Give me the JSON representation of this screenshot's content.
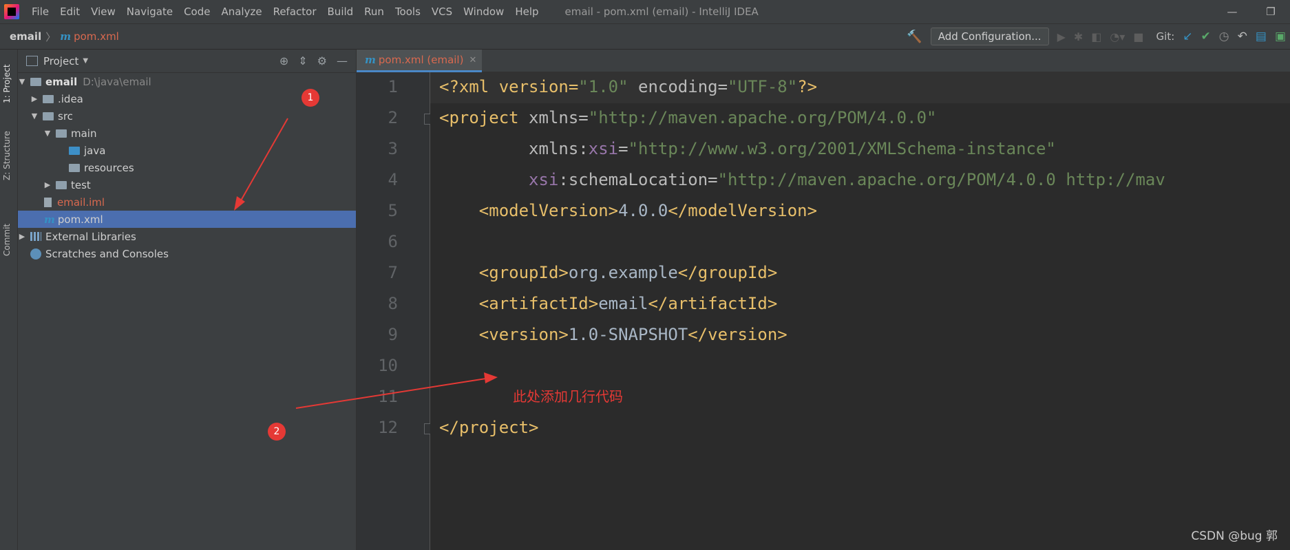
{
  "menubar": {
    "logo": "intellij-logo",
    "items": [
      "File",
      "Edit",
      "View",
      "Navigate",
      "Code",
      "Analyze",
      "Refactor",
      "Build",
      "Run",
      "Tools",
      "VCS",
      "Window",
      "Help"
    ],
    "window_title": "email - pom.xml (email) - IntelliJ IDEA",
    "minimize": "—",
    "restore": "❐"
  },
  "navbar": {
    "project": "email",
    "file": "pom.xml",
    "add_configuration": "Add Configuration...",
    "git_label": "Git:"
  },
  "sidebar_tabs": [
    "1: Project",
    "Z: Structure",
    "Commit"
  ],
  "project_panel": {
    "title": "Project",
    "tree": {
      "root": {
        "name": "email",
        "path": "D:\\java\\email"
      },
      "idea": ".idea",
      "src": "src",
      "main": "main",
      "java": "java",
      "resources": "resources",
      "test": "test",
      "email_iml": "email.iml",
      "pom": "pom.xml",
      "external_libraries": "External Libraries",
      "scratches": "Scratches and Consoles"
    }
  },
  "editor": {
    "tab_label": "pom.xml (email)",
    "line_numbers": [
      "1",
      "2",
      "3",
      "4",
      "5",
      "6",
      "7",
      "8",
      "9",
      "10",
      "11",
      "12"
    ],
    "lines": {
      "l1": {
        "a": "<?xml version=",
        "b": "\"1.0\"",
        "c": " encoding=",
        "d": "\"UTF-8\"",
        "e": "?>"
      },
      "l2": {
        "a": "<project ",
        "b": "xmlns",
        "c": "=",
        "d": "\"http://maven.apache.org/POM/4.0.0\""
      },
      "l3": {
        "a": "         xmlns:",
        "b": "xsi",
        "c": "=",
        "d": "\"http://www.w3.org/2001/XMLSchema-instance\""
      },
      "l4": {
        "a": "         ",
        "b": "xsi",
        "c": ":schemaLocation=",
        "d": "\"http://maven.apache.org/POM/4.0.0 http://mav"
      },
      "l5": {
        "a": "    <modelVersion>",
        "b": "4.0.0",
        "c": "</modelVersion>"
      },
      "l7": {
        "a": "    <groupId>",
        "b": "org.example",
        "c": "</groupId>"
      },
      "l8": {
        "a": "    <artifactId>",
        "b": "email",
        "c": "</artifactId>"
      },
      "l9": {
        "a": "    <version>",
        "b": "1.0-SNAPSHOT",
        "c": "</version>"
      },
      "l12": {
        "a": "</project>"
      }
    }
  },
  "annotations": {
    "badge_1": "1",
    "badge_2": "2",
    "note": "此处添加几行代码",
    "color": "#e53935"
  },
  "watermark": "CSDN @bug 郭"
}
